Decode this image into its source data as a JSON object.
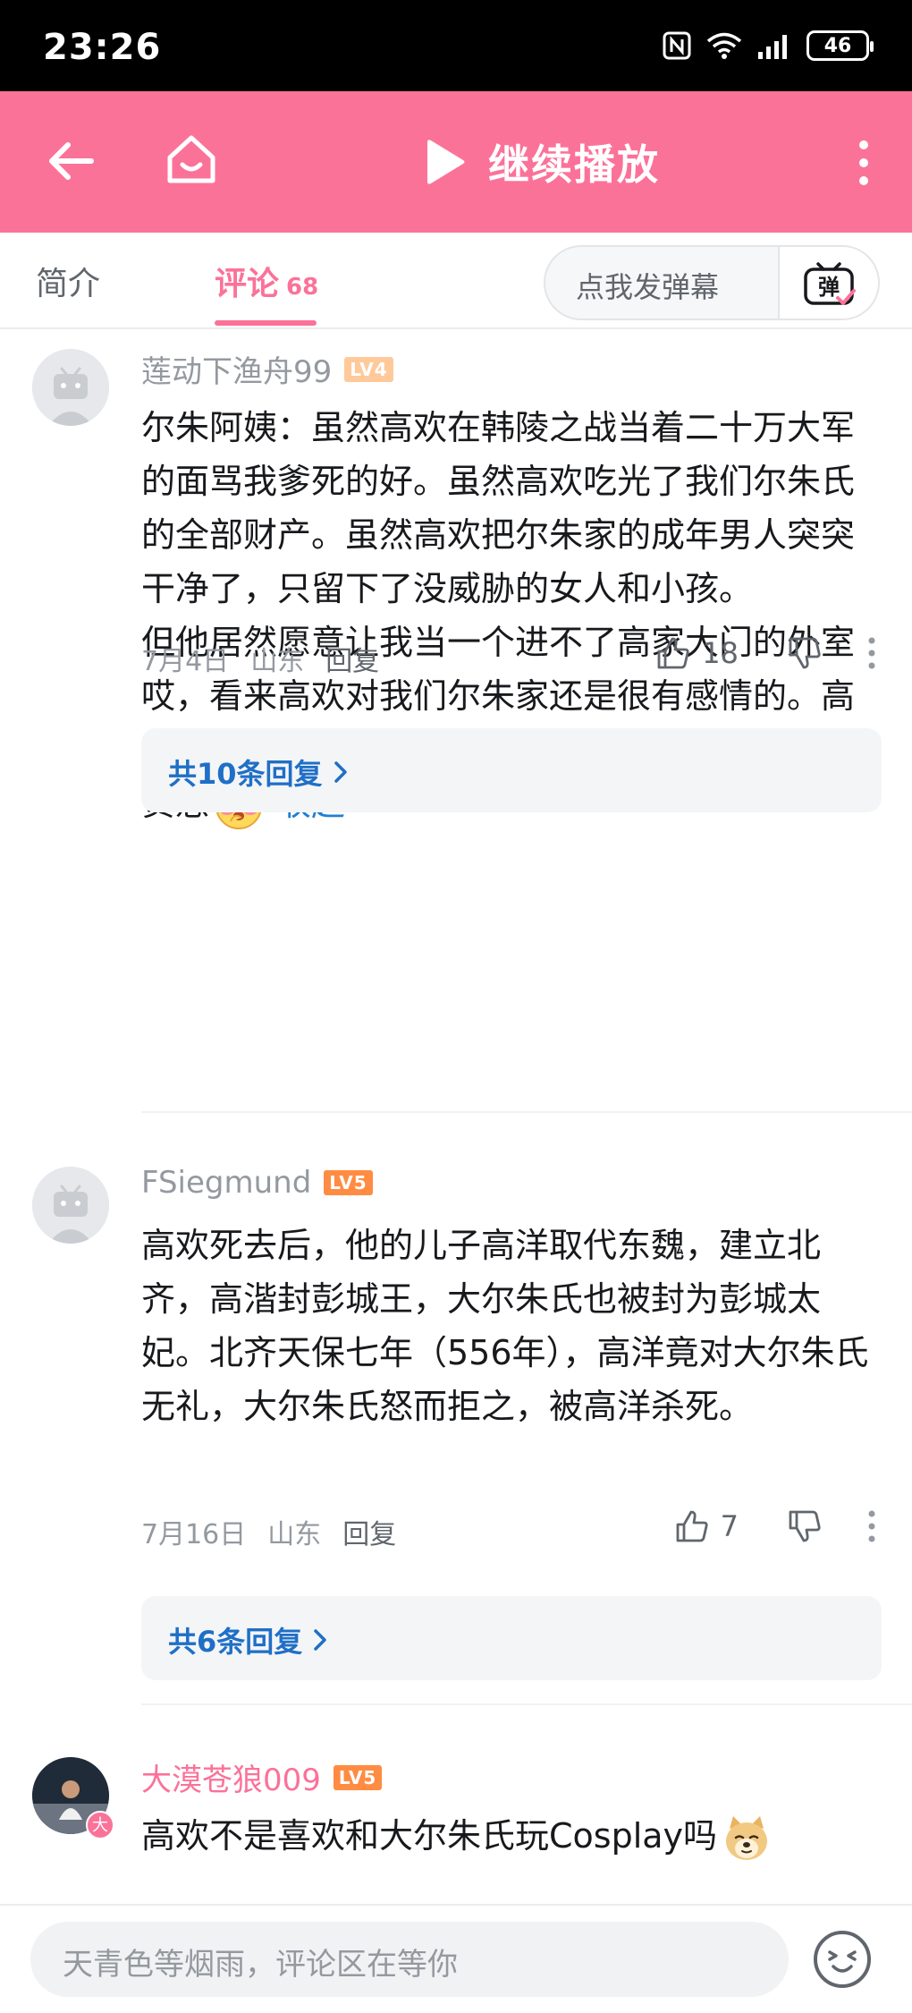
{
  "status_bar": {
    "time": "23:26",
    "battery": "46"
  },
  "header": {
    "title": "继续播放"
  },
  "tabs": {
    "intro_label": "简介",
    "comments_label": "评论",
    "comments_count": "68",
    "danmaku_placeholder": "点我发弹幕",
    "danmaku_icon_text": "弹"
  },
  "comments": [
    {
      "username": "莲动下渔舟99",
      "level": "LV4",
      "paragraphs": [
        "尔朱阿姨：虽然高欢在韩陵之战当着二十万大军的面骂我爹死的好。虽然高欢吃光了我们尔朱氏的全部财产。虽然高欢把尔朱家的成年男人突突干净了，只留下了没威胁的女人和小孩。",
        "但他居然愿意让我当一个进不了高家大门的外室哎，看来高欢对我们尔朱家还是很有感情的。高欢还在口头上对我自称下官哎，看来我真的好尊贵惹"
      ],
      "emoji": "shy-blush-emoji",
      "collapse_label": "收起",
      "date": "7月4日",
      "location": "山东",
      "reply_label": "回复",
      "likes": "18",
      "replies_summary": "共10条回复"
    },
    {
      "username": "FSiegmund",
      "level": "LV5",
      "paragraphs": [
        "高欢死去后，他的儿子高洋取代东魏，建立北齐，高湝封彭城王，大尔朱氏也被封为彭城太妃。北齐天保七年（556年），高洋竟对大尔朱氏无礼，大尔朱氏怒而拒之，被高洋杀死。"
      ],
      "date": "7月16日",
      "location": "山东",
      "reply_label": "回复",
      "likes": "7",
      "replies_summary": "共6条回复"
    },
    {
      "username": "大漠苍狼009",
      "level": "LV5",
      "avatar_badge": "大",
      "paragraphs": [
        "高欢不是喜欢和大尔朱氏玩Cosplay吗"
      ],
      "emoji": "doge-emoji"
    }
  ],
  "bottom": {
    "input_placeholder": "天青色等烟雨，评论区在等你"
  },
  "colors": {
    "brand_pink": "#fb7299",
    "link_blue": "#1f6fc6",
    "lv4": "#ffc99a",
    "lv5": "#ff8c42"
  }
}
